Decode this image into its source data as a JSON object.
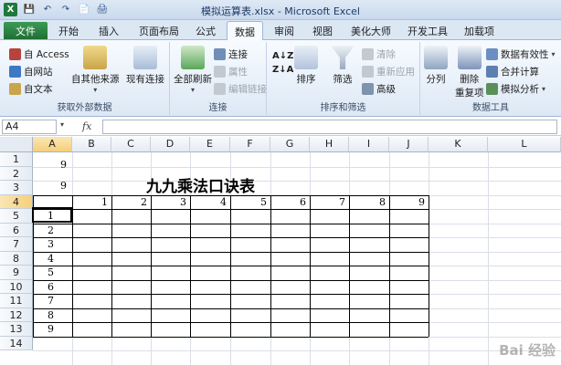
{
  "window": {
    "title": "模拟运算表.xlsx - Microsoft Excel",
    "logo_letter": "X"
  },
  "qat": {
    "save": "💾",
    "undo": "↶",
    "redo": "↷",
    "new": "📄",
    "print": "🖨"
  },
  "tabs": [
    {
      "label": "文件"
    },
    {
      "label": "开始"
    },
    {
      "label": "插入"
    },
    {
      "label": "页面布局"
    },
    {
      "label": "公式"
    },
    {
      "label": "数据"
    },
    {
      "label": "审阅"
    },
    {
      "label": "视图"
    },
    {
      "label": "美化大师"
    },
    {
      "label": "开发工具"
    },
    {
      "label": "加载项"
    }
  ],
  "active_tab": "数据",
  "ribbon": {
    "external": {
      "label": "获取外部数据",
      "from_access": "自 Access",
      "from_web": "自网站",
      "from_text": "自文本",
      "from_other": "自其他来源",
      "existing": "现有连接"
    },
    "connections": {
      "label": "连接",
      "refresh_all": "全部刷新",
      "connections": "连接",
      "properties": "属性",
      "edit_links": "编辑链接"
    },
    "sort_filter": {
      "label": "排序和筛选",
      "sort": "排序",
      "filter": "筛选",
      "clear": "清除",
      "reapply": "重新应用",
      "advanced": "高级"
    },
    "data_tools": {
      "label": "数据工具",
      "text_to_columns": "分列",
      "remove_dup": "删除",
      "remove_dup2": "重复项",
      "validation": "数据有效性",
      "consolidate": "合并计算",
      "whatif": "模拟分析"
    }
  },
  "formula_bar": {
    "name_box": "A4",
    "fx": "fx",
    "content": ""
  },
  "columns": [
    "A",
    "B",
    "C",
    "D",
    "E",
    "F",
    "G",
    "H",
    "I",
    "J",
    "K",
    "L"
  ],
  "rows": [
    "1",
    "2",
    "3",
    "4",
    "5",
    "6",
    "7",
    "8",
    "9",
    "10",
    "11",
    "12",
    "13",
    "14"
  ],
  "cells": {
    "a1": "9",
    "a2": "9",
    "title": "九九乘法口诀表",
    "header_row": [
      "1",
      "2",
      "3",
      "4",
      "5",
      "6",
      "7",
      "8",
      "9"
    ],
    "header_col": [
      "1",
      "2",
      "3",
      "4",
      "5",
      "6",
      "7",
      "8",
      "9"
    ]
  },
  "watermark": "Bai 经验"
}
